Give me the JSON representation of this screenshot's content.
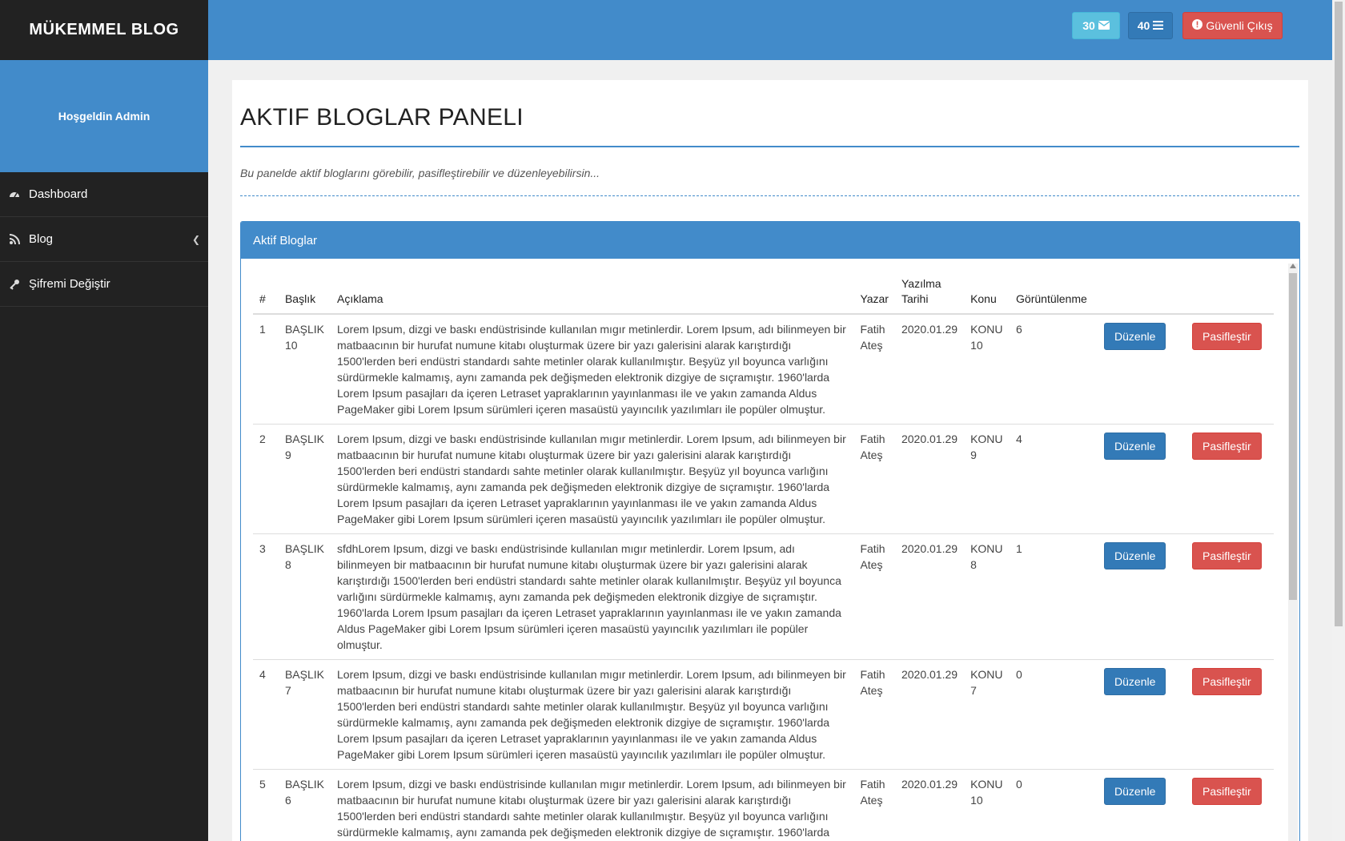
{
  "brand": "MÜKEMMEL BLOG",
  "welcome": "Hoşgeldin Admin",
  "sidebar": {
    "items": [
      {
        "label": "Dashboard",
        "icon": "dashboard-icon"
      },
      {
        "label": "Blog",
        "icon": "blog-icon"
      },
      {
        "label": "Şifremi Değiştir",
        "icon": "key-icon"
      }
    ]
  },
  "topbar": {
    "messages_count": "30",
    "list_count": "40",
    "logout_label": "Güvenli Çıkış"
  },
  "main": {
    "title": "AKTIF BLOGLAR PANELI",
    "subtitle": "Bu panelde aktif bloglarını görebilir, pasifleştirebilir ve düzenleyebilirsin...",
    "panel_title": "Aktif Bloglar",
    "columns": [
      "#",
      "Başlık",
      "Açıklama",
      "Yazar",
      "Yazılma Tarihi",
      "Konu",
      "Görüntülenme"
    ],
    "edit_label": "Düzenle",
    "passive_label": "Pasifleştir",
    "rows": [
      {
        "num": "1",
        "title": "BAŞLIK 10",
        "desc": "Lorem Ipsum, dizgi ve baskı endüstrisinde kullanılan mıgır metinlerdir. Lorem Ipsum, adı bilinmeyen bir matbaacının bir hurufat numune kitabı oluşturmak üzere bir yazı galerisini alarak karıştırdığı 1500'lerden beri endüstri standardı sahte metinler olarak kullanılmıştır. Beşyüz yıl boyunca varlığını sürdürmekle kalmamış, aynı zamanda pek değişmeden elektronik dizgiye de sıçramıştır. 1960'larda Lorem Ipsum pasajları da içeren Letraset yapraklarının yayınlanması ile ve yakın zamanda Aldus PageMaker gibi Lorem Ipsum sürümleri içeren masaüstü yayıncılık yazılımları ile popüler olmuştur.",
        "author": "Fatih Ateş",
        "date": "2020.01.29",
        "topic": "KONU 10",
        "views": "6"
      },
      {
        "num": "2",
        "title": "BAŞLIK 9",
        "desc": "Lorem Ipsum, dizgi ve baskı endüstrisinde kullanılan mıgır metinlerdir. Lorem Ipsum, adı bilinmeyen bir matbaacının bir hurufat numune kitabı oluşturmak üzere bir yazı galerisini alarak karıştırdığı 1500'lerden beri endüstri standardı sahte metinler olarak kullanılmıştır. Beşyüz yıl boyunca varlığını sürdürmekle kalmamış, aynı zamanda pek değişmeden elektronik dizgiye de sıçramıştır. 1960'larda Lorem Ipsum pasajları da içeren Letraset yapraklarının yayınlanması ile ve yakın zamanda Aldus PageMaker gibi Lorem Ipsum sürümleri içeren masaüstü yayıncılık yazılımları ile popüler olmuştur.",
        "author": "Fatih Ateş",
        "date": "2020.01.29",
        "topic": "KONU 9",
        "views": "4"
      },
      {
        "num": "3",
        "title": "BAŞLIK 8",
        "desc": "sfdhLorem Ipsum, dizgi ve baskı endüstrisinde kullanılan mıgır metinlerdir. Lorem Ipsum, adı bilinmeyen bir matbaacının bir hurufat numune kitabı oluşturmak üzere bir yazı galerisini alarak karıştırdığı 1500'lerden beri endüstri standardı sahte metinler olarak kullanılmıştır. Beşyüz yıl boyunca varlığını sürdürmekle kalmamış, aynı zamanda pek değişmeden elektronik dizgiye de sıçramıştır. 1960'larda Lorem Ipsum pasajları da içeren Letraset yapraklarının yayınlanması ile ve yakın zamanda Aldus PageMaker gibi Lorem Ipsum sürümleri içeren masaüstü yayıncılık yazılımları ile popüler olmuştur.",
        "author": "Fatih Ateş",
        "date": "2020.01.29",
        "topic": "KONU 8",
        "views": "1"
      },
      {
        "num": "4",
        "title": "BAŞLIK 7",
        "desc": "Lorem Ipsum, dizgi ve baskı endüstrisinde kullanılan mıgır metinlerdir. Lorem Ipsum, adı bilinmeyen bir matbaacının bir hurufat numune kitabı oluşturmak üzere bir yazı galerisini alarak karıştırdığı 1500'lerden beri endüstri standardı sahte metinler olarak kullanılmıştır. Beşyüz yıl boyunca varlığını sürdürmekle kalmamış, aynı zamanda pek değişmeden elektronik dizgiye de sıçramıştır. 1960'larda Lorem Ipsum pasajları da içeren Letraset yapraklarının yayınlanması ile ve yakın zamanda Aldus PageMaker gibi Lorem Ipsum sürümleri içeren masaüstü yayıncılık yazılımları ile popüler olmuştur.",
        "author": "Fatih Ateş",
        "date": "2020.01.29",
        "topic": "KONU 7",
        "views": "0"
      },
      {
        "num": "5",
        "title": "BAŞLIK 6",
        "desc": "Lorem Ipsum, dizgi ve baskı endüstrisinde kullanılan mıgır metinlerdir. Lorem Ipsum, adı bilinmeyen bir matbaacının bir hurufat numune kitabı oluşturmak üzere bir yazı galerisini alarak karıştırdığı 1500'lerden beri endüstri standardı sahte metinler olarak kullanılmıştır. Beşyüz yıl boyunca varlığını sürdürmekle kalmamış, aynı zamanda pek değişmeden elektronik dizgiye de sıçramıştır. 1960'larda",
        "author": "Fatih Ateş",
        "date": "2020.01.29",
        "topic": "KONU 10",
        "views": "0"
      }
    ]
  },
  "colors": {
    "primary": "#428bca",
    "sidebar": "#222222",
    "info": "#5bc0de",
    "danger": "#d9534f",
    "edit": "#337ab7"
  }
}
